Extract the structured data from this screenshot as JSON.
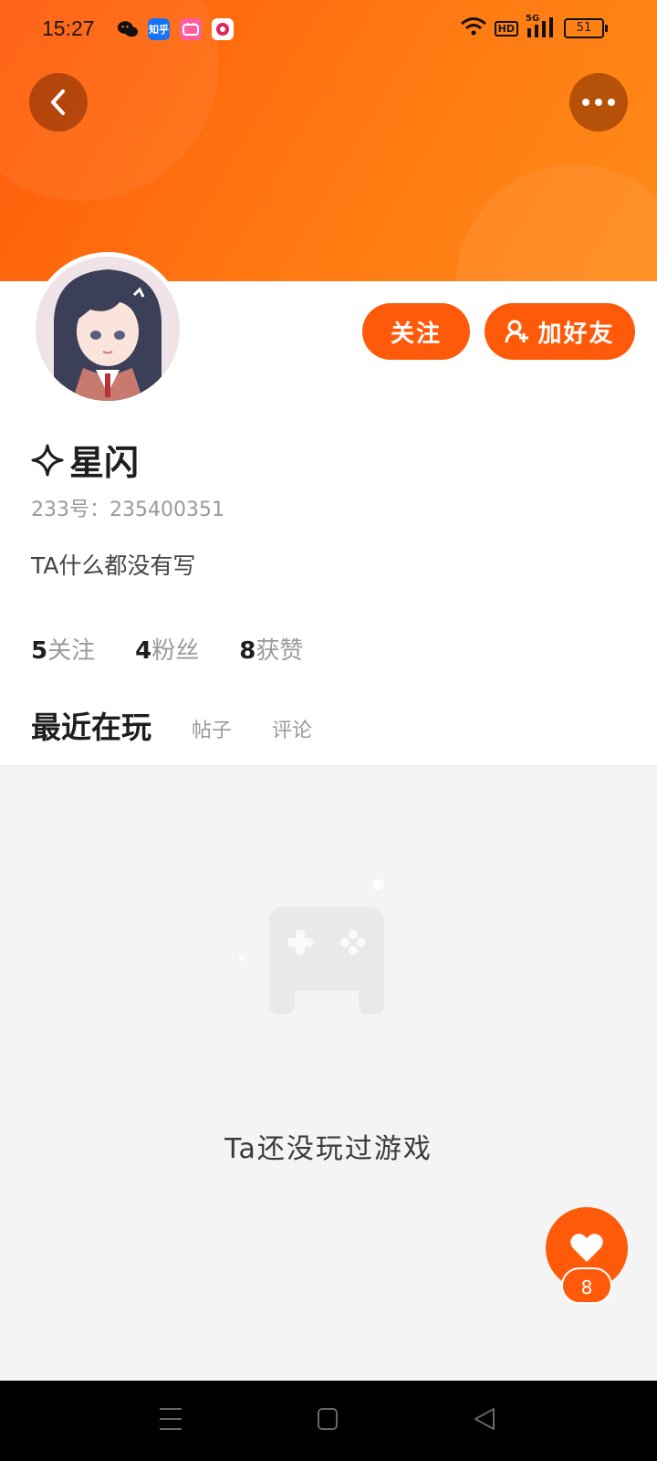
{
  "status_bar": {
    "time": "15:27",
    "battery": "51",
    "network": "5G",
    "hd": "HD",
    "zhihu_icon_text": "知乎"
  },
  "header": {
    "back_icon": "chevron-left-icon",
    "more_icon": "more-dots-icon"
  },
  "profile": {
    "nickname": "星闪",
    "id_label": "233号：",
    "id_value": "235400351",
    "bio": "TA什么都没有写",
    "follow_label": "关注",
    "add_friend_label": "加好友"
  },
  "stats": [
    {
      "num": "5",
      "label": "关注"
    },
    {
      "num": "4",
      "label": "粉丝"
    },
    {
      "num": "8",
      "label": "获赞"
    }
  ],
  "tabs": [
    {
      "label": "最近在玩",
      "active": true
    },
    {
      "label": "帖子",
      "active": false
    },
    {
      "label": "评论",
      "active": false
    }
  ],
  "empty_state": {
    "text": "Ta还没玩过游戏",
    "icon": "gamepad-icon"
  },
  "like": {
    "count": "8",
    "icon": "heart-icon"
  },
  "colors": {
    "accent": "#ff5a0a",
    "background": "#f4f4f4"
  }
}
